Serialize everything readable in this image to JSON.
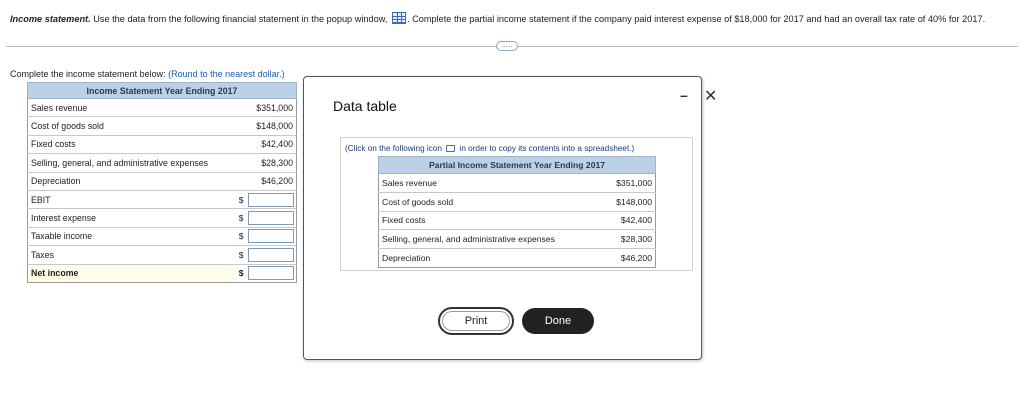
{
  "question": {
    "title": "Income statement.",
    "text_before_icon": " Use the data from the following financial statement in the popup window,",
    "text_after_icon": ". Complete the partial income statement if the company paid interest expense of $18,000 for 2017 and had an overall tax rate of 40% for 2017.",
    "more_label": "....."
  },
  "instructions": {
    "text": "Complete the income statement below: ",
    "hint": "(Round to the nearest dollar.)"
  },
  "statement": {
    "header": "Income Statement Year Ending 2017",
    "given_rows": [
      {
        "label": "Sales revenue",
        "value": "$351,000"
      },
      {
        "label": "Cost of goods sold",
        "value": "$148,000"
      },
      {
        "label": "Fixed costs",
        "value": "$42,400"
      },
      {
        "label": "Selling, general, and administrative expenses",
        "value": "$28,300"
      },
      {
        "label": "Depreciation",
        "value": "$46,200"
      }
    ],
    "input_rows": [
      {
        "label": "EBIT",
        "currency": "$",
        "value": ""
      },
      {
        "label": "Interest expense",
        "currency": "$",
        "value": ""
      },
      {
        "label": "Taxable income",
        "currency": "$",
        "value": ""
      },
      {
        "label": "Taxes",
        "currency": "$",
        "value": ""
      },
      {
        "label": "Net income",
        "currency": "$",
        "value": ""
      }
    ]
  },
  "modal": {
    "title": "Data table",
    "minimize_label": "–",
    "close_label": "✕",
    "copy_hint_before": "(Click on the following icon",
    "copy_hint_after": "in order to copy its contents into a spreadsheet.)",
    "table_header": "Partial Income Statement Year Ending 2017",
    "rows": [
      {
        "label": "Sales revenue",
        "value": "$351,000"
      },
      {
        "label": "Cost of goods sold",
        "value": "$148,000"
      },
      {
        "label": "Fixed costs",
        "value": "$42,400"
      },
      {
        "label": "Selling, general, and administrative expenses",
        "value": "$28,300"
      },
      {
        "label": "Depreciation",
        "value": "$46,200"
      }
    ],
    "print_label": "Print",
    "done_label": "Done"
  }
}
